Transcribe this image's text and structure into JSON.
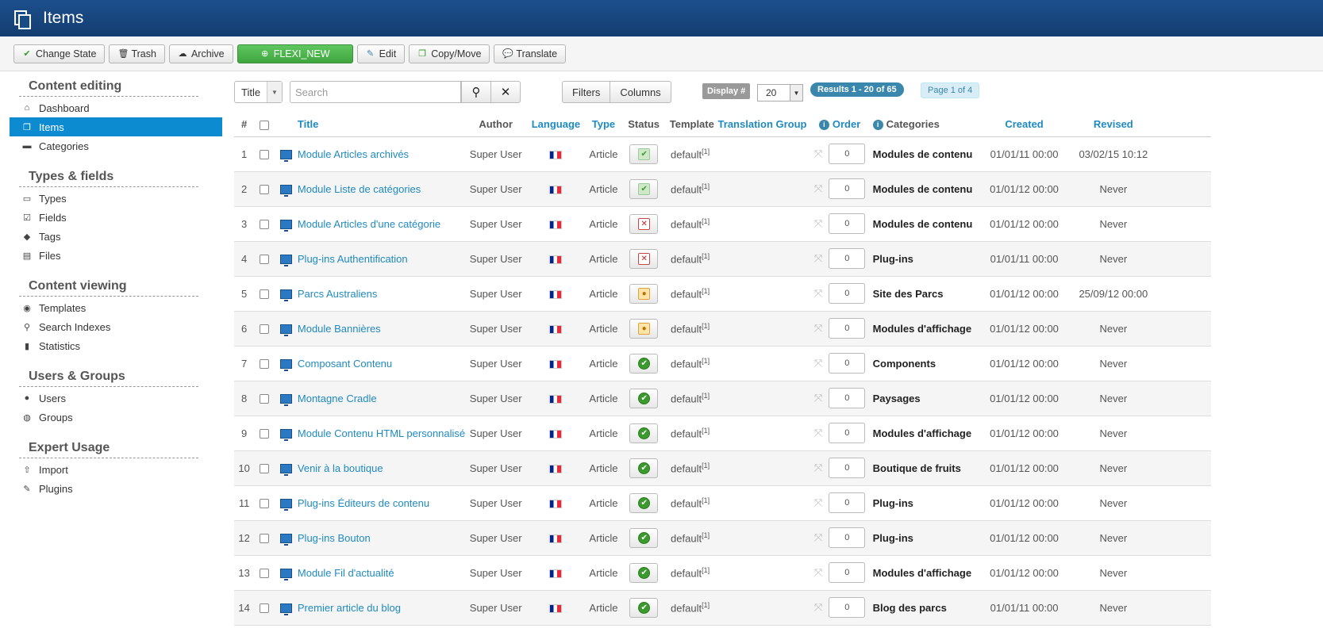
{
  "header": {
    "title": "Items"
  },
  "toolbar": {
    "change_state": "Change State",
    "trash": "Trash",
    "archive": "Archive",
    "new": "FLEXI_NEW",
    "edit": "Edit",
    "copy_move": "Copy/Move",
    "translate": "Translate"
  },
  "sidebar": {
    "sections": [
      {
        "title": "Content editing",
        "items": [
          {
            "label": "Dashboard",
            "icon": "home-icon"
          },
          {
            "label": "Items",
            "icon": "copy-icon",
            "active": true
          },
          {
            "label": "Categories",
            "icon": "folder-icon"
          }
        ]
      },
      {
        "title": "Types & fields",
        "items": [
          {
            "label": "Types",
            "icon": "types-icon"
          },
          {
            "label": "Fields",
            "icon": "checkbox-icon"
          },
          {
            "label": "Tags",
            "icon": "tag-icon"
          },
          {
            "label": "Files",
            "icon": "image-icon"
          }
        ]
      },
      {
        "title": "Content viewing",
        "items": [
          {
            "label": "Templates",
            "icon": "eye-icon"
          },
          {
            "label": "Search Indexes",
            "icon": "search-icon"
          },
          {
            "label": "Statistics",
            "icon": "chart-icon"
          }
        ]
      },
      {
        "title": "Users & Groups",
        "items": [
          {
            "label": "Users",
            "icon": "user-icon"
          },
          {
            "label": "Groups",
            "icon": "users-icon"
          }
        ]
      },
      {
        "title": "Expert Usage",
        "items": [
          {
            "label": "Import",
            "icon": "upload-icon"
          },
          {
            "label": "Plugins",
            "icon": "plug-icon"
          }
        ]
      }
    ]
  },
  "filters": {
    "search_field": "Title",
    "search_placeholder": "Search",
    "filters_btn": "Filters",
    "columns_btn": "Columns",
    "display_label": "Display #",
    "display_value": "20",
    "results": "Results 1 - 20 of 65",
    "page": "Page 1 of 4"
  },
  "table": {
    "headers": {
      "num": "#",
      "title": "Title",
      "author": "Author",
      "language": "Language",
      "type": "Type",
      "status": "Status",
      "template": "Template",
      "translation_group": "Translation Group",
      "order": "Order",
      "categories": "Categories",
      "created": "Created",
      "revised": "Revised"
    },
    "rows": [
      {
        "num": "1",
        "title": "Module Articles archivés",
        "author": "Super User",
        "type": "Article",
        "status": "chk",
        "template": "default",
        "tsup": "[1]",
        "order": "0",
        "category": "Modules de contenu",
        "created": "01/01/11 00:00",
        "revised": "03/02/15 10:12"
      },
      {
        "num": "2",
        "title": "Module Liste de catégories",
        "author": "Super User",
        "type": "Article",
        "status": "chk",
        "template": "default",
        "tsup": "[1]",
        "order": "0",
        "category": "Modules de contenu",
        "created": "01/01/12 00:00",
        "revised": "Never"
      },
      {
        "num": "3",
        "title": "Module Articles d'une catégorie",
        "author": "Super User",
        "type": "Article",
        "status": "unp",
        "template": "default",
        "tsup": "[1]",
        "order": "0",
        "category": "Modules de contenu",
        "created": "01/01/12 00:00",
        "revised": "Never"
      },
      {
        "num": "4",
        "title": "Plug-ins Authentification",
        "author": "Super User",
        "type": "Article",
        "status": "unp",
        "template": "default",
        "tsup": "[1]",
        "order": "0",
        "category": "Plug-ins",
        "created": "01/01/11 00:00",
        "revised": "Never"
      },
      {
        "num": "5",
        "title": "Parcs Australiens",
        "author": "Super User",
        "type": "Article",
        "status": "pend",
        "template": "default",
        "tsup": "[1]",
        "order": "0",
        "category": "Site des Parcs",
        "created": "01/01/12 00:00",
        "revised": "25/09/12 00:00"
      },
      {
        "num": "6",
        "title": "Module Bannières",
        "author": "Super User",
        "type": "Article",
        "status": "pend",
        "template": "default",
        "tsup": "[1]",
        "order": "0",
        "category": "Modules d'affichage",
        "created": "01/01/12 00:00",
        "revised": "Never"
      },
      {
        "num": "7",
        "title": "Composant Contenu",
        "author": "Super User",
        "type": "Article",
        "status": "pub",
        "template": "default",
        "tsup": "[1]",
        "order": "0",
        "category": "Components",
        "created": "01/01/12 00:00",
        "revised": "Never"
      },
      {
        "num": "8",
        "title": "Montagne Cradle",
        "author": "Super User",
        "type": "Article",
        "status": "pub",
        "template": "default",
        "tsup": "[1]",
        "order": "0",
        "category": "Paysages",
        "created": "01/01/12 00:00",
        "revised": "Never"
      },
      {
        "num": "9",
        "title": "Module Contenu HTML personnalisé",
        "author": "Super User",
        "type": "Article",
        "status": "pub",
        "template": "default",
        "tsup": "[1]",
        "order": "0",
        "category": "Modules d'affichage",
        "created": "01/01/12 00:00",
        "revised": "Never"
      },
      {
        "num": "10",
        "title": "Venir à la boutique",
        "author": "Super User",
        "type": "Article",
        "status": "pub",
        "template": "default",
        "tsup": "[1]",
        "order": "0",
        "category": "Boutique de fruits",
        "created": "01/01/12 00:00",
        "revised": "Never"
      },
      {
        "num": "11",
        "title": "Plug-ins Éditeurs de contenu",
        "author": "Super User",
        "type": "Article",
        "status": "pub",
        "template": "default",
        "tsup": "[1]",
        "order": "0",
        "category": "Plug-ins",
        "created": "01/01/12 00:00",
        "revised": "Never"
      },
      {
        "num": "12",
        "title": "Plug-ins Bouton",
        "author": "Super User",
        "type": "Article",
        "status": "pub",
        "template": "default",
        "tsup": "[1]",
        "order": "0",
        "category": "Plug-ins",
        "created": "01/01/12 00:00",
        "revised": "Never"
      },
      {
        "num": "13",
        "title": "Module Fil d'actualité",
        "author": "Super User",
        "type": "Article",
        "status": "pub",
        "template": "default",
        "tsup": "[1]",
        "order": "0",
        "category": "Modules d'affichage",
        "created": "01/01/12 00:00",
        "revised": "Never"
      },
      {
        "num": "14",
        "title": "Premier article du blog",
        "author": "Super User",
        "type": "Article",
        "status": "pub",
        "template": "default",
        "tsup": "[1]",
        "order": "0",
        "category": "Blog des parcs",
        "created": "01/01/11 00:00",
        "revised": "Never"
      }
    ]
  }
}
